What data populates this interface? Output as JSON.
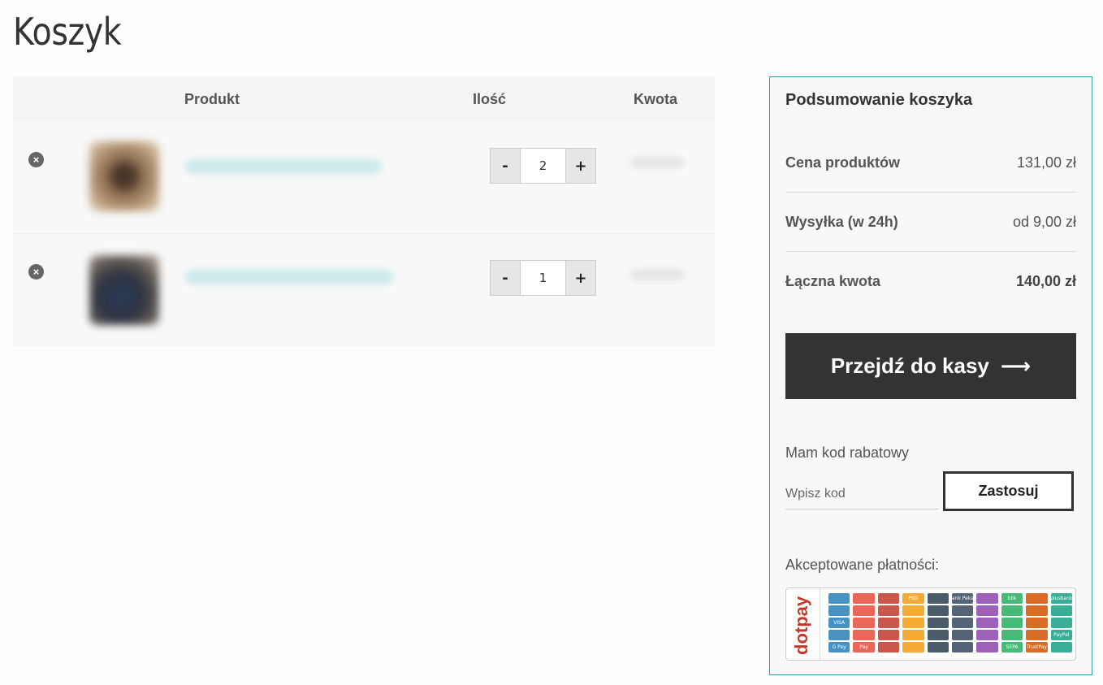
{
  "page": {
    "title": "Koszyk"
  },
  "cart": {
    "columns": {
      "product": "Produkt",
      "quantity": "Ilość",
      "amount": "Kwota"
    },
    "items": [
      {
        "quantity": "2"
      },
      {
        "quantity": "1"
      }
    ],
    "minus_label": "-",
    "plus_label": "+",
    "remove_icon": "×"
  },
  "summary": {
    "title": "Podsumowanie koszyka",
    "rows": [
      {
        "label": "Cena produktów",
        "value": "131,00 zł"
      },
      {
        "label": "Wysyłka (w 24h)",
        "value": "od 9,00 zł"
      },
      {
        "label": "Łączna kwota",
        "value": "140,00 zł"
      }
    ],
    "checkout_label": "Przejdź do kasy",
    "checkout_arrow": "⟶",
    "coupon": {
      "label": "Mam kod rabatowy",
      "placeholder": "Wpisz kod",
      "apply_label": "Zastosuj"
    },
    "payments": {
      "label": "Akceptowane płatności:",
      "provider": "dotpay",
      "logos": [
        "",
        "",
        "",
        "PKO",
        "",
        "Bank Pekao",
        "",
        "blik",
        "",
        "plusbank",
        "",
        "",
        "",
        "",
        "",
        "",
        "",
        "",
        "",
        "",
        "VISA",
        "",
        "",
        "",
        "",
        "",
        "",
        "",
        "",
        "",
        "",
        "",
        "",
        "",
        "",
        "",
        "",
        "",
        "",
        "PayPal",
        "G Pay",
        "Pay",
        "",
        "",
        "",
        "",
        "",
        "SEPA",
        "TrustPay",
        ""
      ]
    }
  },
  "colors": {
    "accent": "#2aa198",
    "dark": "#333333",
    "brand": "#c0392b"
  }
}
